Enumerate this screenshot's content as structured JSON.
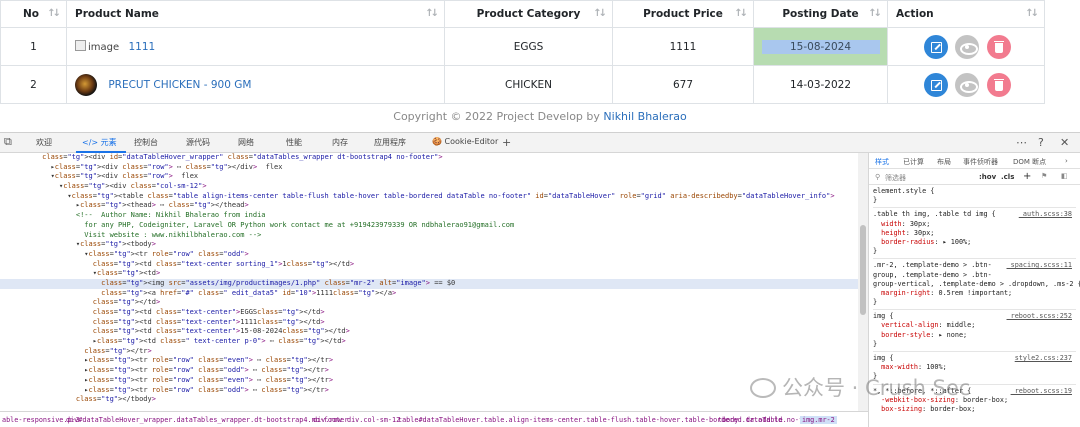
{
  "table": {
    "headers": {
      "no": "No",
      "name": "Product Name",
      "category": "Product Category",
      "price": "Product Price",
      "date": "Posting Date",
      "action": "Action"
    },
    "sort_glyph": "↑↓",
    "rows": [
      {
        "no": "1",
        "image_alt": "image",
        "name": "1111",
        "category": "EGGS",
        "price": "1111",
        "date": "15-08-2024"
      },
      {
        "no": "2",
        "image_alt": "",
        "name": "PRECUT CHICKEN - 900 GM",
        "category": "CHICKEN",
        "price": "677",
        "date": "14-03-2022"
      }
    ]
  },
  "footer": {
    "copyright": "Copyright © 2022 Project Develop by ",
    "author": "Nikhil Bhalerao"
  },
  "devtools": {
    "tabs": [
      "欢迎",
      "元素",
      "控制台",
      "源代码",
      "网络",
      "性能",
      "内存",
      "应用程序",
      "Cookie-Editor"
    ],
    "add_tab": "+",
    "right_icons": [
      "⋯",
      "?",
      "✕"
    ],
    "elements": [
      {
        "i": 5,
        "t": "<div id=\"dataTableHover_wrapper\" class=\"dataTables_wrapper dt-bootstrap4 no-footer\">"
      },
      {
        "i": 6,
        "t": "▸<div class=\"row\"> ⋯ </div>  flex"
      },
      {
        "i": 6,
        "t": "▾<div class=\"row\">  flex"
      },
      {
        "i": 7,
        "t": "▾<div class=\"col-sm-12\">"
      },
      {
        "i": 8,
        "t": "▾<table class=\"table align-items-center table-flush table-hover table-bordered dataTable no-footer\" id=\"dataTableHover\" role=\"grid\" aria-describedby=\"dataTableHover_info\">"
      },
      {
        "i": 9,
        "t": "▸<thead> ⋯ </thead>"
      },
      {
        "i": 9,
        "t": "<!--  Author Name: Nikhil Bhalerao from india"
      },
      {
        "i": 10,
        "t": "for any PHP, Codeigniter, Laravel OR Python work contact me at +919423979339 OR ndbhalerao91@gmail.com"
      },
      {
        "i": 10,
        "t": "Visit website : www.nikhilbhalerao.com -->"
      },
      {
        "i": 9,
        "t": "▾<tbody>"
      },
      {
        "i": 10,
        "t": "▾<tr role=\"row\" class=\"odd\">"
      },
      {
        "i": 11,
        "t": "<td class=\"text-center sorting_1\">1</td>"
      },
      {
        "i": 11,
        "t": "▾<td>"
      },
      {
        "i": 12,
        "t": "<img src=\"assets/img/productimages/1.php\" class=\"mr-2\" alt=\"image\"> == $0"
      },
      {
        "i": 12,
        "t": "<a href=\"#\" class=\" edit_data5\" id=\"10\">1111</a>"
      },
      {
        "i": 11,
        "t": "</td>"
      },
      {
        "i": 11,
        "t": "<td class=\"text-center\">EGGS</td>"
      },
      {
        "i": 11,
        "t": "<td class=\"text-center\">1111</td>"
      },
      {
        "i": 11,
        "t": "<td class=\"text-center\">15-08-2024</td>"
      },
      {
        "i": 11,
        "t": "▸<td class=\" text-center p-0\"> ⋯ </td>"
      },
      {
        "i": 10,
        "t": "</tr>"
      },
      {
        "i": 10,
        "t": "▸<tr role=\"row\" class=\"even\"> ⋯ </tr>"
      },
      {
        "i": 10,
        "t": "▸<tr role=\"row\" class=\"odd\"> ⋯ </tr>"
      },
      {
        "i": 10,
        "t": "▸<tr role=\"row\" class=\"even\"> ⋯ </tr>"
      },
      {
        "i": 10,
        "t": "▸<tr role=\"row\" class=\"odd\"> ⋯ </tr>"
      },
      {
        "i": 9,
        "t": "</tbody>"
      }
    ],
    "breadcrumb": [
      "able-responsive.p-3",
      "div#dataTableHover_wrapper.dataTables_wrapper.dt-bootstrap4.no-footer",
      "div.row",
      "div.col-sm-12",
      "table#dataTableHover.table.align-items-center.table-flush.table-hover.table-bordered.dataTable.no-footer",
      "tbody",
      "tr.odd",
      "td",
      "img.mr-2"
    ],
    "styles_tabs": [
      "样式",
      "已计算",
      "布局",
      "事件侦听器",
      "DOM 断点",
      "›"
    ],
    "filter_placeholder": "筛选器",
    "filter_tools": [
      ":hov",
      ".cls",
      "+"
    ],
    "styles": [
      {
        "type": "sel",
        "t": "element.style {"
      },
      {
        "type": "sel",
        "t": "}"
      },
      {
        "type": "sep"
      },
      {
        "type": "sel",
        "t": ".table th img, .table td img {",
        "src": "_auth.scss:38"
      },
      {
        "type": "prop",
        "p": "width",
        "v": "30px;"
      },
      {
        "type": "prop",
        "p": "height",
        "v": "30px;"
      },
      {
        "type": "prop",
        "p": "border-radius",
        "v": "▸ 100%;"
      },
      {
        "type": "sel",
        "t": "}"
      },
      {
        "type": "sep"
      },
      {
        "type": "sel",
        "t": ".mr-2, .template-demo > .btn-",
        "src": "_spacing.scss:11"
      },
      {
        "type": "sel",
        "t": "group, .template-demo > .btn-"
      },
      {
        "type": "sel",
        "t": "group-vertical, .template-demo > .dropdown, .ms-2 {"
      },
      {
        "type": "prop",
        "p": "margin-right",
        "v": "0.5rem !important;"
      },
      {
        "type": "sel",
        "t": "}"
      },
      {
        "type": "sep"
      },
      {
        "type": "sel",
        "t": "img {",
        "src": "_reboot.scss:252"
      },
      {
        "type": "prop",
        "p": "vertical-align",
        "v": "middle;"
      },
      {
        "type": "prop",
        "p": "border-style",
        "v": "▸ none;"
      },
      {
        "type": "sel",
        "t": "}"
      },
      {
        "type": "sep"
      },
      {
        "type": "sel",
        "t": "img {",
        "src": "style2.css:237"
      },
      {
        "type": "prop",
        "p": "max-width",
        "v": "100%;"
      },
      {
        "type": "sel",
        "t": "}"
      },
      {
        "type": "sep"
      },
      {
        "type": "sel",
        "t": "*, *::before, *::after {",
        "src": "_reboot.scss:19"
      },
      {
        "type": "prop",
        "p": "-webkit-box-sizing",
        "v": "border-box;"
      },
      {
        "type": "prop",
        "p": "box-sizing",
        "v": "border-box;"
      }
    ]
  },
  "watermark": "公众号 · Crush Sec"
}
